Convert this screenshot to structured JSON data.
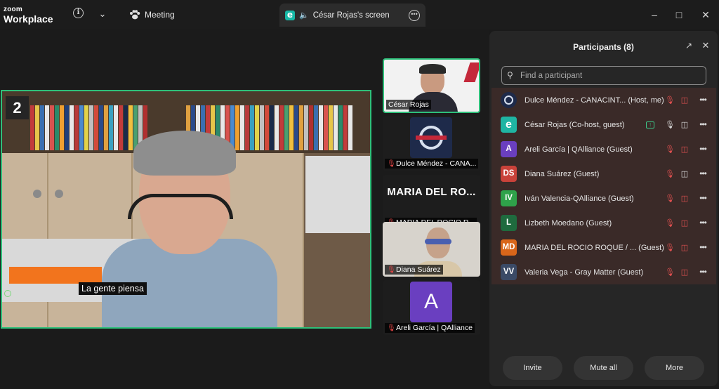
{
  "app": {
    "brand_top": "zoom",
    "brand_bottom": "Workplace",
    "meeting_label": "Meeting",
    "screen_tab_label": "César Rojas's screen"
  },
  "main_video": {
    "tile_number": "2",
    "caption": "La gente piensa"
  },
  "thumbnails": [
    {
      "name": "César Rojas",
      "muted": false
    },
    {
      "name": "Dulce Méndez - CANA...",
      "muted": true
    },
    {
      "name": "MARIA DEL ROCIO R...",
      "big_name": "MARIA DEL RO...",
      "muted": true
    },
    {
      "name": "Diana Suárez",
      "muted": true
    },
    {
      "name": "Areli García | QAlliance",
      "avatar_letter": "A",
      "muted": true
    }
  ],
  "panel": {
    "title": "Participants (8)",
    "search_placeholder": "Find a participant",
    "participants": [
      {
        "avatar": "",
        "avatar_color": "#1e2a4a",
        "name": "Dulce Méndez - CANACINT... (Host, me)",
        "mic": "muted",
        "video": "off"
      },
      {
        "avatar": "e",
        "avatar_color": "#1fb5a3",
        "name": "César Rojas (Co-host, guest)",
        "mic": "on",
        "video": "on",
        "sharing": true
      },
      {
        "avatar": "A",
        "avatar_color": "#6a3fc0",
        "name": "Areli García | QAlliance (Guest)",
        "mic": "muted",
        "video": "off"
      },
      {
        "avatar": "DS",
        "avatar_color": "#c9423a",
        "name": "Diana Suárez (Guest)",
        "mic": "muted",
        "video": "on"
      },
      {
        "avatar": "IV",
        "avatar_color": "#2fa24a",
        "name": "Iván Valencia-QAlliance (Guest)",
        "mic": "muted",
        "video": "off"
      },
      {
        "avatar": "L",
        "avatar_color": "#1f6b3e",
        "name": "Lizbeth Moedano (Guest)",
        "mic": "muted",
        "video": "off"
      },
      {
        "avatar": "MD",
        "avatar_color": "#d9661a",
        "name": "MARIA DEL ROCIO ROQUE / ...  (Guest)",
        "mic": "muted",
        "video": "off"
      },
      {
        "avatar": "VV",
        "avatar_color": "#3b4a66",
        "name": "Valeria Vega - Gray Matter (Guest)",
        "mic": "muted",
        "video": "off"
      }
    ],
    "buttons": {
      "invite": "Invite",
      "mute_all": "Mute all",
      "more": "More"
    }
  }
}
